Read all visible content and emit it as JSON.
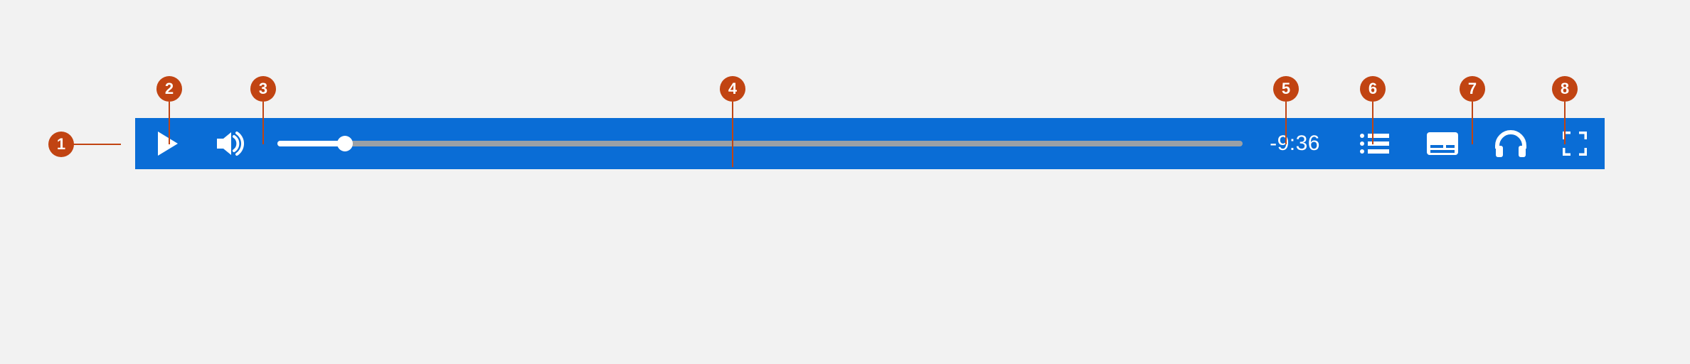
{
  "player": {
    "play_label": "Play",
    "volume_label": "Volume",
    "time_remaining": "-9:36",
    "progress_percent": 7,
    "chapters_label": "Chapters",
    "captions_label": "Captions",
    "audio_desc_label": "Audio description",
    "fullscreen_label": "Fullscreen",
    "accent": "#0a6dd6",
    "callout_accent": "#c14412"
  },
  "callouts": [
    {
      "n": "1",
      "target": "player-bar"
    },
    {
      "n": "2",
      "target": "play-button"
    },
    {
      "n": "3",
      "target": "volume-button"
    },
    {
      "n": "4",
      "target": "seek-slider"
    },
    {
      "n": "5",
      "target": "chapters-button"
    },
    {
      "n": "6",
      "target": "captions-button"
    },
    {
      "n": "7",
      "target": "audio-description-button"
    },
    {
      "n": "8",
      "target": "fullscreen-button"
    }
  ]
}
